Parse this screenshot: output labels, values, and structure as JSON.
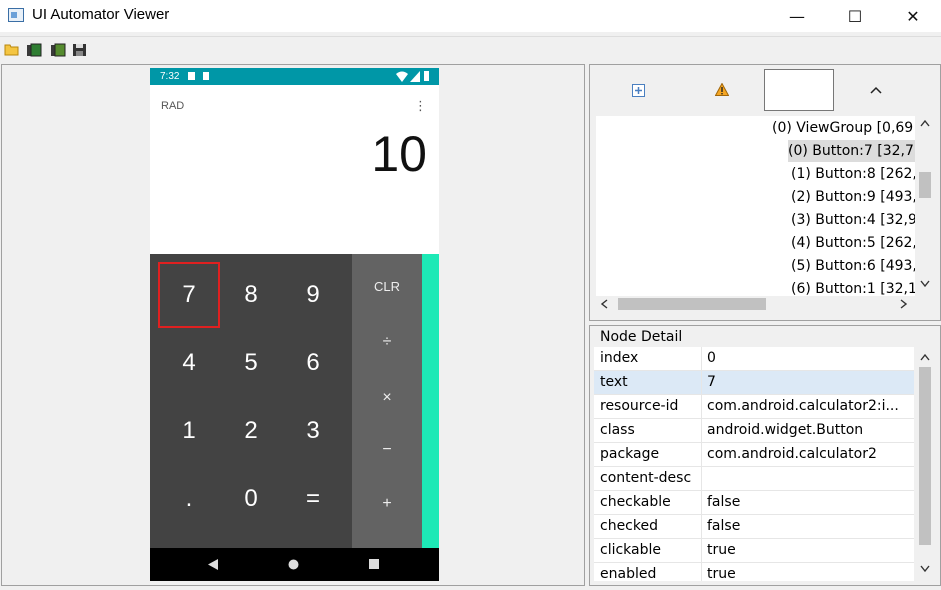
{
  "window": {
    "title": "UI Automator Viewer",
    "minimize": "—",
    "maximize": "☐",
    "close": "✕"
  },
  "phone": {
    "status_time": "7:32",
    "mode": "RAD",
    "display": "10",
    "numpad": [
      "7",
      "8",
      "9",
      "4",
      "5",
      "6",
      "1",
      "2",
      "3",
      ".",
      "0",
      "="
    ],
    "ops": [
      "CLR",
      "÷",
      "×",
      "−",
      "+"
    ]
  },
  "tree": {
    "rows": [
      "(0) ViewGroup [0,69",
      "(0) Button:7 [32,7",
      "(1) Button:8 [262,",
      "(2) Button:9 [493,",
      "(3) Button:4 [32,9",
      "(4) Button:5 [262,",
      "(5) Button:6 [493,",
      "(6) Button:1 [32,1"
    ]
  },
  "node_detail": {
    "title": "Node Detail",
    "rows": [
      {
        "key": "index",
        "value": "0"
      },
      {
        "key": "text",
        "value": "7"
      },
      {
        "key": "resource-id",
        "value": "com.android.calculator2:i..."
      },
      {
        "key": "class",
        "value": "android.widget.Button"
      },
      {
        "key": "package",
        "value": "com.android.calculator2"
      },
      {
        "key": "content-desc",
        "value": ""
      },
      {
        "key": "checkable",
        "value": "false"
      },
      {
        "key": "checked",
        "value": "false"
      },
      {
        "key": "clickable",
        "value": "true"
      },
      {
        "key": "enabled",
        "value": "true"
      }
    ]
  },
  "colors": {
    "status_bar": "#0097a7",
    "numpad_bg": "#434343",
    "ops_bg": "#636363",
    "accent": "#1de9b6",
    "selection_box": "#e02020"
  }
}
